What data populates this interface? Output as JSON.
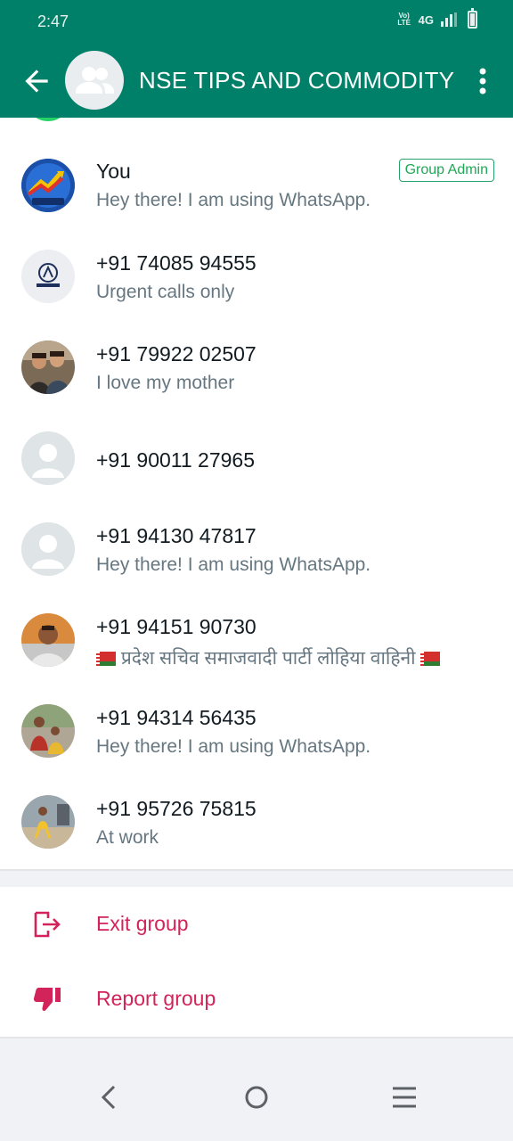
{
  "status_bar": {
    "time": "2:47",
    "volte_label": "Vo) LTE",
    "network": "4G"
  },
  "header": {
    "title": "NSE TIPS AND COMMODITY",
    "background": "#008069"
  },
  "members": [
    {
      "name": "You",
      "about": "Hey there! I am using WhatsApp.",
      "badge": "Group Admin",
      "avatar": "mcx-live-logo"
    },
    {
      "name": "+91 74085 94555",
      "about": "Urgent calls only",
      "avatar": "aman-logo"
    },
    {
      "name": "+91 79922 02507",
      "about": "I love my mother",
      "avatar": "photo-people"
    },
    {
      "name": "+91 90011 27965",
      "about": "",
      "avatar": "default-person-icon"
    },
    {
      "name": "+91 94130 47817",
      "about": "Hey there! I am using WhatsApp.",
      "avatar": "default-person-icon"
    },
    {
      "name": "+91 94151 90730",
      "about": "प्रदेश सचिव समाजवादी पार्टी लोहिया वाहिनी",
      "avatar": "photo-man"
    },
    {
      "name": "+91 94314 56435",
      "about": "Hey there! I am using WhatsApp.",
      "avatar": "photo-family"
    },
    {
      "name": "+91 95726 75815",
      "about": "At work",
      "avatar": "photo-child"
    }
  ],
  "actions": {
    "exit_label": "Exit group",
    "report_label": "Report group",
    "danger_color": "#d2245a"
  }
}
